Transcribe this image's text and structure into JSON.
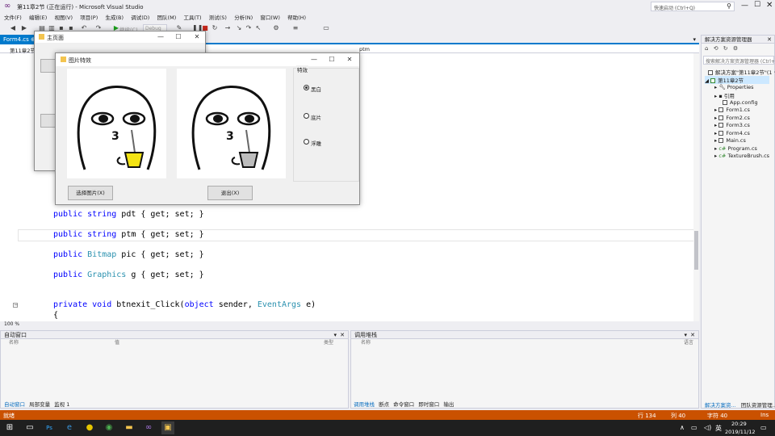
{
  "window": {
    "title": "第11章2节 (正在运行) - Microsoft Visual Studio",
    "quick_launch": "快速启动 (Ctrl+Q)"
  },
  "menu": [
    "文件(F)",
    "编辑(E)",
    "视图(V)",
    "项目(P)",
    "生成(B)",
    "调试(D)",
    "团队(M)",
    "工具(T)",
    "测试(S)",
    "分析(N)",
    "窗口(W)",
    "帮助(H)"
  ],
  "toolbar": {
    "continue_label": "继续(C)",
    "config": "Debug"
  },
  "doc_tab": {
    "name": "Form4.cs"
  },
  "nav": {
    "left": "第11章2节",
    "right": "ptm"
  },
  "code": {
    "l1": {
      "kw": "public string",
      "rest": " pdt { get; set; }"
    },
    "l2": {
      "kw": "public string",
      "rest": " ptm { get; set; }"
    },
    "l3": {
      "kw": "public",
      "type": "Bitmap",
      "rest": " pic { get; set; }"
    },
    "l4": {
      "kw": "public",
      "type": "Graphics",
      "rest": " g { get; set; }"
    },
    "l5": {
      "kw": "private void",
      "rest1": " btnexit_Click(",
      "kw2": "object",
      "rest2": " sender, ",
      "type": "EventArgs",
      "rest3": " e)"
    },
    "l6": "{"
  },
  "zoom": "100 %",
  "autos": {
    "title": "自动窗口",
    "col_name": "名称",
    "col_value": "值",
    "col_type": "类型",
    "tabs": [
      "自动窗口",
      "局部变量",
      "监视 1"
    ]
  },
  "callstack": {
    "title": "调用堆栈",
    "col_name": "名称",
    "col_lang": "语言",
    "tabs": [
      "调用堆栈",
      "断点",
      "命令窗口",
      "即时窗口",
      "输出"
    ]
  },
  "solution": {
    "title": "解决方案资源管理器",
    "search": "搜索解决方案资源管理器 (Ctrl+;)",
    "root": "解决方案\"第11章2节\"(1 个",
    "project": "第11章2节",
    "items": [
      "Properties",
      "引用",
      "App.config",
      "Form1.cs",
      "Form2.cs",
      "Form3.cs",
      "Form4.cs",
      "Main.cs",
      "Program.cs",
      "TextureBrush.cs"
    ],
    "tabs": [
      "解决方案资...",
      "团队资源管理..."
    ]
  },
  "status": {
    "ready": "就绪",
    "row": "行 134",
    "col": "列 40",
    "char": "字符 40",
    "ins": "Ins"
  },
  "main_form": {
    "title": "主页面"
  },
  "effect_form": {
    "title": "图片特效",
    "group": "特效",
    "options": [
      "黑白",
      "底片",
      "浮雕"
    ],
    "selected": 0,
    "select_btn": "选择图片(X)",
    "exit_btn": "退出(X)"
  },
  "taskbar": {
    "time": "20:29",
    "date": "2019/11/12",
    "ime": "英"
  },
  "colors": {
    "accent": "#007acc",
    "status_debug": "#ca5100"
  }
}
